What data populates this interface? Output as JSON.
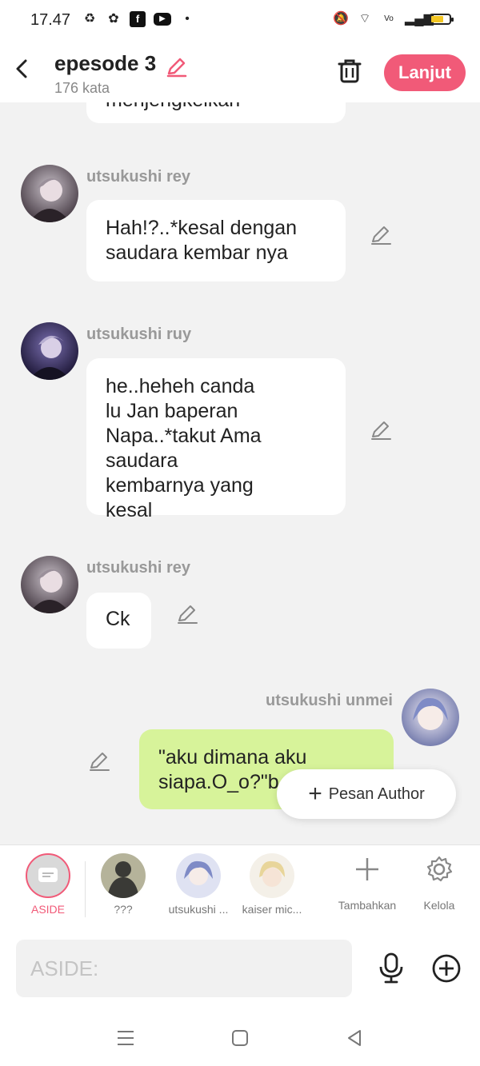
{
  "status_bar": {
    "time": "17.47"
  },
  "header": {
    "title": "epesode 3",
    "word_count": "176 kata",
    "next_label": "Lanjut"
  },
  "messages": [
    {
      "name": "",
      "text": "menjengkelkan"
    },
    {
      "name": "utsukushi rey",
      "text": "Hah!?..*kesal  dengan saudara kembar nya"
    },
    {
      "name": "utsukushi ruy",
      "text": "he..heheh canda lu Jan baperan Napa..*takut Ama saudara kembarnya yang kesal"
    },
    {
      "name": "utsukushi rey",
      "text": "Ck"
    },
    {
      "name": "utsukushi unmei",
      "text": "\"aku dimana aku siapa.O_o?\"b"
    }
  ],
  "pesan_author_label": "Pesan Author",
  "characters": [
    {
      "label": "ASIDE"
    },
    {
      "label": "???"
    },
    {
      "label": "utsukushi ..."
    },
    {
      "label": "kaiser mic..."
    }
  ],
  "add_label": "Tambahkan",
  "manage_label": "Kelola",
  "input": {
    "placeholder": "ASIDE:"
  },
  "colors": {
    "accent": "#f15a78",
    "bubble_green": "#d7f39a",
    "bubble_white": "#ffffff"
  },
  "icons": [
    "back-icon",
    "pencil-icon",
    "trash-icon",
    "edit-icon",
    "plus-icon",
    "gear-icon",
    "mic-icon",
    "plus-circle-icon",
    "menu-icon",
    "home-icon",
    "back-triangle-icon"
  ]
}
